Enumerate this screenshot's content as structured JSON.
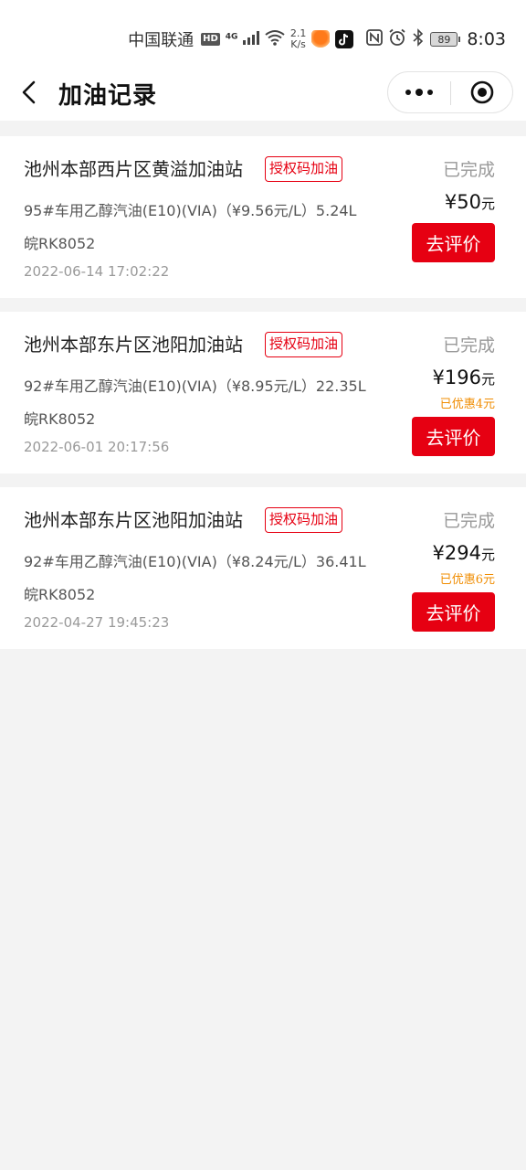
{
  "status_bar": {
    "carrier": "中国联通",
    "hd": "HD",
    "network": "4G",
    "speed_value": "2.1",
    "speed_unit": "K/s",
    "battery": "89",
    "time": "8:03",
    "icons": [
      "hd-icon",
      "signal-icon",
      "wifi-icon",
      "app-icon",
      "tiktok-icon",
      "nfc-icon",
      "alarm-icon",
      "bluetooth-icon",
      "battery-icon"
    ]
  },
  "nav": {
    "title": "加油记录",
    "back_icon": "chevron-left-icon",
    "more_icon": "more-dots-icon",
    "close_icon": "target-close-icon"
  },
  "colors": {
    "accent": "#e60012",
    "discount": "#f08c00",
    "background": "#f3f3f3"
  },
  "records": [
    {
      "station": "池州本部西片区黄溢加油站",
      "tag": "授权码加油",
      "status": "已完成",
      "fuel": "95#车用乙醇汽油(E10)(VIA)（¥9.56元/L）5.24L",
      "plate": "皖RK8052",
      "time": "2022-06-14 17:02:22",
      "amount": "¥50",
      "unit": "元",
      "discount": "",
      "button": "去评价"
    },
    {
      "station": "池州本部东片区池阳加油站",
      "tag": "授权码加油",
      "status": "已完成",
      "fuel": "92#车用乙醇汽油(E10)(VIA)（¥8.95元/L）22.35L",
      "plate": "皖RK8052",
      "time": "2022-06-01 20:17:56",
      "amount": "¥196",
      "unit": "元",
      "discount": "已优惠4元",
      "button": "去评价"
    },
    {
      "station": "池州本部东片区池阳加油站",
      "tag": "授权码加油",
      "status": "已完成",
      "fuel": "92#车用乙醇汽油(E10)(VIA)（¥8.24元/L）36.41L",
      "plate": "皖RK8052",
      "time": "2022-04-27 19:45:23",
      "amount": "¥294",
      "unit": "元",
      "discount": "已优惠6元",
      "button": "去评价"
    }
  ]
}
